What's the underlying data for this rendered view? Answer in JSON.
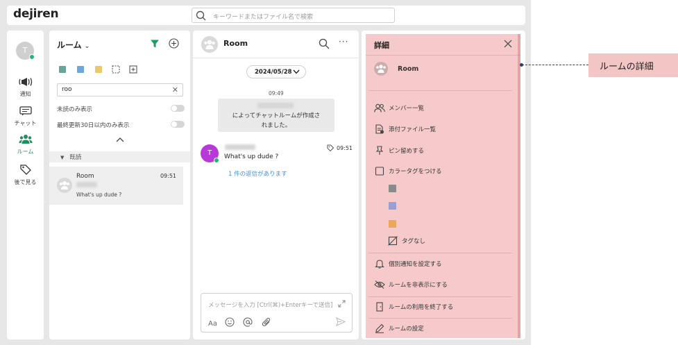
{
  "app": {
    "logo": "dejiren"
  },
  "search": {
    "placeholder": "キーワードまたはファイル名で検索"
  },
  "rail": {
    "avatar_initial": "T",
    "items": [
      {
        "label": "通知",
        "icon": "megaphone-icon"
      },
      {
        "label": "チャット",
        "icon": "chat-icon"
      },
      {
        "label": "ルーム",
        "icon": "people-icon",
        "active": true
      },
      {
        "label": "後で見る",
        "icon": "bookmark-tag-icon"
      }
    ]
  },
  "room_list": {
    "title": "ルーム",
    "tag_colors": [
      "#6aa39a",
      "#6fa8d8",
      "#e9c96a"
    ],
    "filter_value": "roo",
    "toggles": [
      {
        "label": "未読のみ表示",
        "on": false
      },
      {
        "label": "最終更新30日以内のみ表示",
        "on": false
      }
    ],
    "section_label": "既読",
    "rooms": [
      {
        "name": "Room",
        "time": "09:51",
        "last_message": "What's up dude ?"
      }
    ]
  },
  "chat": {
    "title": "Room",
    "date": "2024/05/28",
    "system_time": "09:49",
    "system_message_line1": "によってチャットルームが作成さ",
    "system_message_line2": "れました。",
    "message": {
      "avatar_initial": "T",
      "avatar_color": "#b73ad8",
      "time": "09:51",
      "text": "What's up dude ?",
      "reply_link": "1 件の返信があります"
    },
    "composer": {
      "placeholder": "メッセージを入力 [Ctrl(⌘)+Enterキーで送信]",
      "font_label": "Aa"
    }
  },
  "detail": {
    "title": "詳細",
    "room_name": "Room",
    "items": {
      "members": "メンバー一覧",
      "files": "添付ファイル一覧",
      "pins": "ピン留めする",
      "color_tag": "カラータグをつける",
      "no_tag": "タグなし",
      "notify": "個別通知を設定する",
      "hide": "ルームを非表示にする",
      "leave": "ルームの利用を終了する",
      "settings": "ルームの設定"
    },
    "color_tags": [
      "#8a8a8a",
      "#9a9ed0",
      "#eba85a"
    ],
    "highlight_color": "#f0aaaa"
  },
  "callout": {
    "label": "ルームの詳細"
  }
}
